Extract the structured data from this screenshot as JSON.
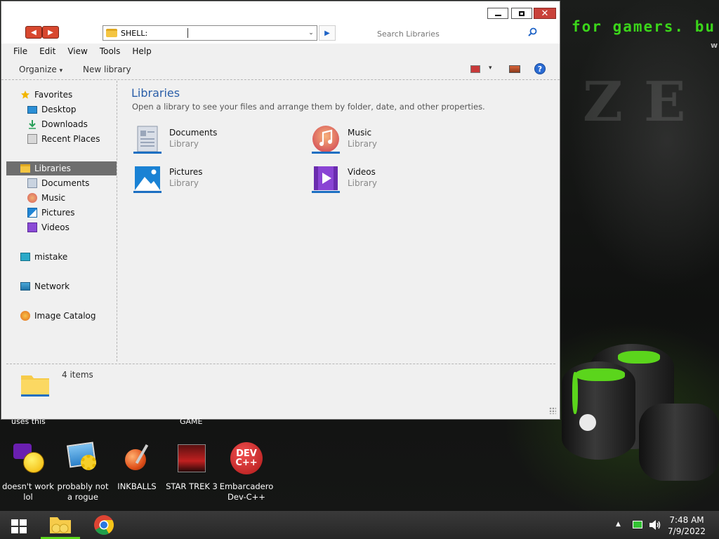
{
  "wallpaper": {
    "slogan": "for gamers. bu",
    "small": "w",
    "big": "ZE"
  },
  "window": {
    "address": "SHELL:",
    "search_placeholder": "Search Libraries",
    "menu": [
      "File",
      "Edit",
      "View",
      "Tools",
      "Help"
    ],
    "toolbar": {
      "organize": "Organize",
      "organize_caret": "▾",
      "new_library": "New library",
      "view_caret": "▾",
      "help": "?"
    },
    "controls": {
      "close": "✕",
      "go": "▶",
      "back": "◀",
      "forward": "▶",
      "address_caret": "⌄"
    },
    "nav": {
      "favorites": "Favorites",
      "desktop": "Desktop",
      "downloads": "Downloads",
      "recent": "Recent Places",
      "libraries": "Libraries",
      "documents": "Documents",
      "music": "Music",
      "pictures": "Pictures",
      "videos": "Videos",
      "computer": "mistake",
      "network": "Network",
      "catalog": "Image Catalog"
    },
    "content": {
      "title": "Libraries",
      "subtitle": "Open a library to see your files and arrange them by folder, date, and other properties.",
      "libraries": [
        {
          "name": "Documents",
          "type": "Library"
        },
        {
          "name": "Music",
          "type": "Library"
        },
        {
          "name": "Pictures",
          "type": "Library"
        },
        {
          "name": "Videos",
          "type": "Library"
        }
      ]
    },
    "status": "4 items"
  },
  "desktop": {
    "peek_left": "uses this",
    "peek_mid": "GAME",
    "icons": [
      {
        "line1": "doesn't work",
        "line2": "lol"
      },
      {
        "line1": "probably not",
        "line2": "a rogue"
      },
      {
        "line1": "INKBALLS",
        "line2": ""
      },
      {
        "line1": "STAR TREK 3",
        "line2": ""
      },
      {
        "line1": "Embarcadero",
        "line2": "Dev-C++"
      }
    ],
    "devcpp_logo": "DEV\nC++"
  },
  "taskbar": {
    "time": "7:48 AM",
    "date": "7/9/2022",
    "tray_caret": "▲"
  },
  "colors": {
    "accent_green": "#5bd51c",
    "link_blue": "#2a5ea8",
    "close_red": "#c9413a"
  }
}
